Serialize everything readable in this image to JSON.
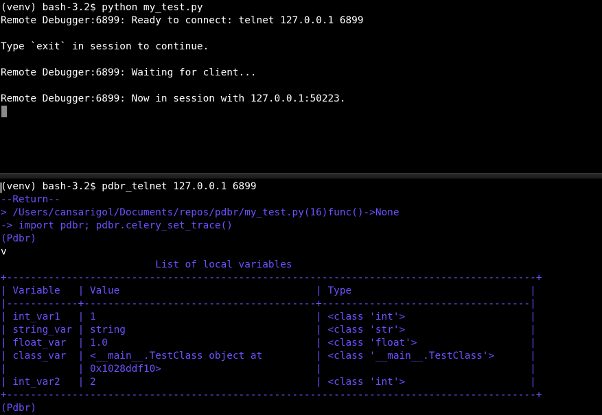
{
  "top_terminal": {
    "lines": [
      "(venv) bash-3.2$ python my_test.py",
      "Remote Debugger:6899: Ready to connect: telnet 127.0.0.1 6899",
      "",
      "Type `exit` in session to continue.",
      "",
      "Remote Debugger:6899: Waiting for client...",
      "",
      "Remote Debugger:6899: Now in session with 127.0.0.1:50223."
    ]
  },
  "bottom_terminal": {
    "prompt_line": "(venv) bash-3.2$ pdbr_telnet 127.0.0.1 6899",
    "return_line": "--Return--",
    "location_line": "> /Users/cansarigol/Documents/repos/pdbr/my_test.py(16)func()->None",
    "arrow_line": "-> import pdbr; pdbr.celery_set_trace()",
    "pdbr_prompt_1": "(Pdbr)",
    "command_line": "v",
    "table_title": "                          List of local variables",
    "table_rows": [
      "+-----------------------------------------------------------------------------------------+",
      "| Variable   | Value                                 | Type                              |",
      "|------------+---------------------------------------+-----------------------------------|",
      "| int_var1   | 1                                     | <class 'int'>                     |",
      "| string_var | string                                | <class 'str'>                     |",
      "| float_var  | 1.0                                   | <class 'float'>                   |",
      "| class_var  | <__main__.TestClass object at         | <class '__main__.TestClass'>      |",
      "|            | 0x1028ddf10>                          |                                   |",
      "| int_var2   | 2                                     | <class 'int'>                     |",
      "+-----------------------------------------------------------------------------------------+"
    ],
    "pdbr_prompt_2": "(Pdbr)"
  },
  "colors": {
    "background": "#000000",
    "text_white": "#ffffff",
    "pdbr_blue": "#6b52ff",
    "cursor": "#8a8a8a"
  }
}
